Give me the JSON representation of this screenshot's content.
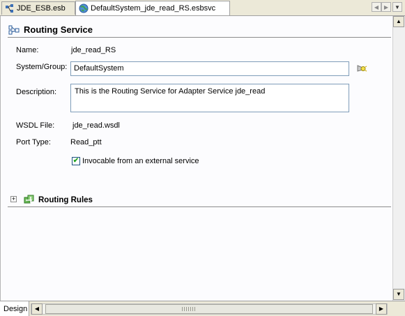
{
  "tabs": [
    {
      "label": "JDE_ESB.esb"
    },
    {
      "label": "DefaultSystem_jde_read_RS.esbsvc"
    }
  ],
  "routing_service": {
    "title": "Routing Service",
    "name_label": "Name:",
    "name_value": "jde_read_RS",
    "system_group_label": "System/Group:",
    "system_group_value": "DefaultSystem",
    "description_label": "Description:",
    "description_value": "This is the Routing Service for Adapter Service jde_read",
    "wsdl_label": "WSDL File:",
    "wsdl_value": "jde_read.wsdl",
    "port_type_label": "Port Type:",
    "port_type_value": "Read_ptt",
    "invocable_label": "Invocable from an external service",
    "invocable_checked": true
  },
  "routing_rules": {
    "title": "Routing Rules",
    "expand_symbol": "+"
  },
  "bottom": {
    "design_tab": "Design"
  },
  "icons": {
    "nav_left": "◀",
    "nav_right": "▶",
    "nav_down": "▼",
    "scroll_up": "▲",
    "scroll_down": "▼",
    "scroll_left": "◀",
    "scroll_right": "▶",
    "check": "✔"
  }
}
